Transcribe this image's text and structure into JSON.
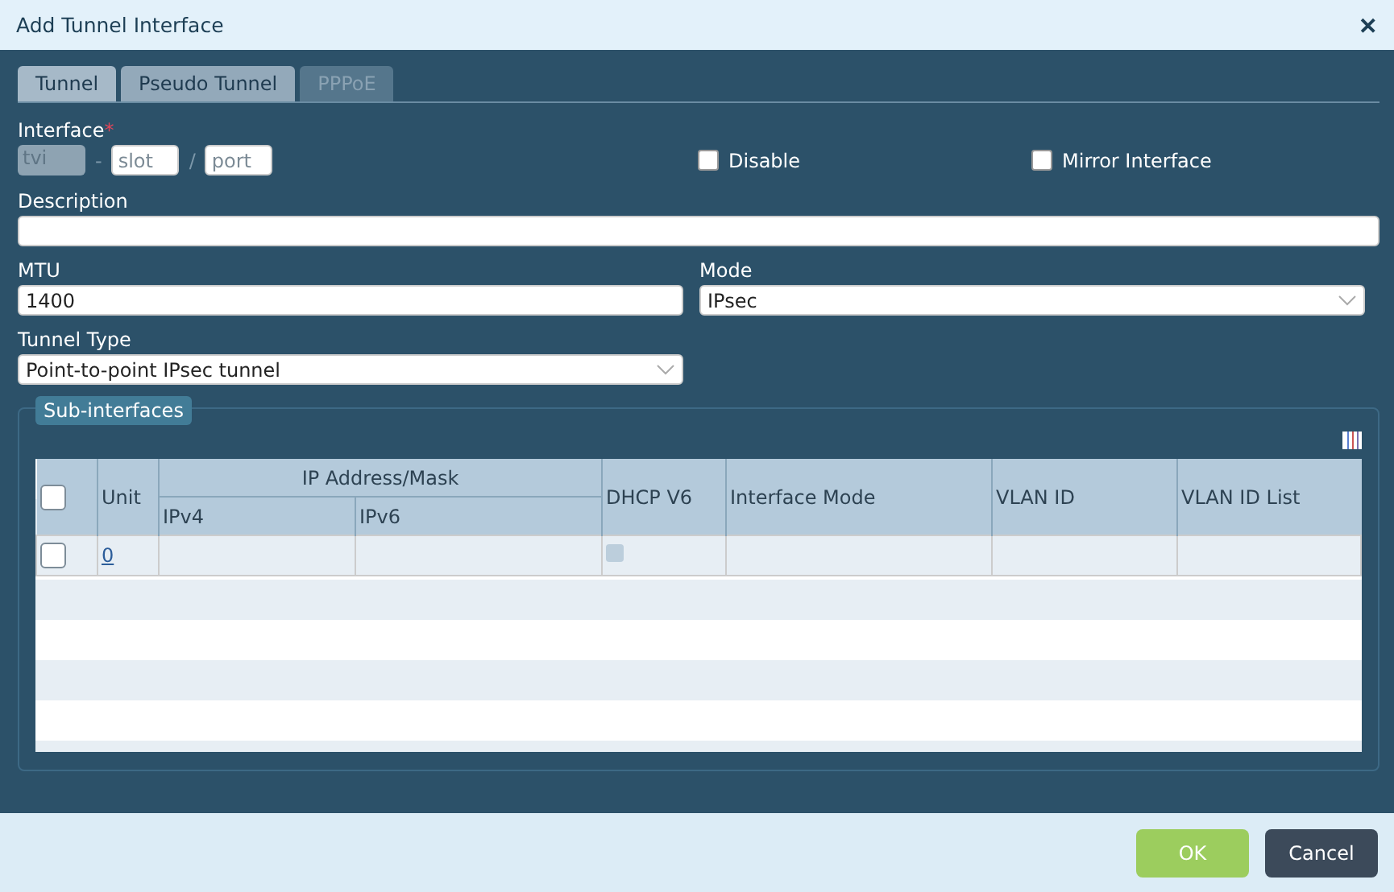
{
  "window": {
    "title": "Add Tunnel Interface",
    "close": "✕"
  },
  "tabs": [
    {
      "label": "Tunnel",
      "selected": true,
      "disabled": false
    },
    {
      "label": "Pseudo Tunnel",
      "selected": false,
      "disabled": false
    },
    {
      "label": "PPPoE",
      "selected": false,
      "disabled": true
    }
  ],
  "interface": {
    "label": "Interface",
    "required_mark": "*",
    "prefix": "tvi",
    "separator_1": "-",
    "slot_placeholder": "slot",
    "separator_2": "/",
    "port_placeholder": "port"
  },
  "options": [
    {
      "label": "Disable",
      "checked": false
    },
    {
      "label": "Mirror Interface",
      "checked": false
    }
  ],
  "description": {
    "label": "Description"
  },
  "mtu": {
    "label": "MTU",
    "value": "1400"
  },
  "mode": {
    "label": "Mode",
    "value": "IPsec"
  },
  "tunnel_type": {
    "label": "Tunnel Type",
    "value": "Point-to-point IPsec tunnel"
  },
  "sub_interfaces": {
    "legend": "Sub-interfaces",
    "table": {
      "group_header": "IP Address/Mask",
      "columns": [
        "Unit",
        "IPv4",
        "IPv6",
        "DHCP V6",
        "Interface Mode",
        "VLAN ID",
        "VLAN ID List"
      ],
      "header_checked": false,
      "rows": [
        {
          "checked": false,
          "unit": "0",
          "dhcp_v6": false
        }
      ]
    }
  },
  "buttons": [
    {
      "label": "OK",
      "kind": "primary"
    },
    {
      "label": "Cancel",
      "kind": "secondary"
    }
  ]
}
